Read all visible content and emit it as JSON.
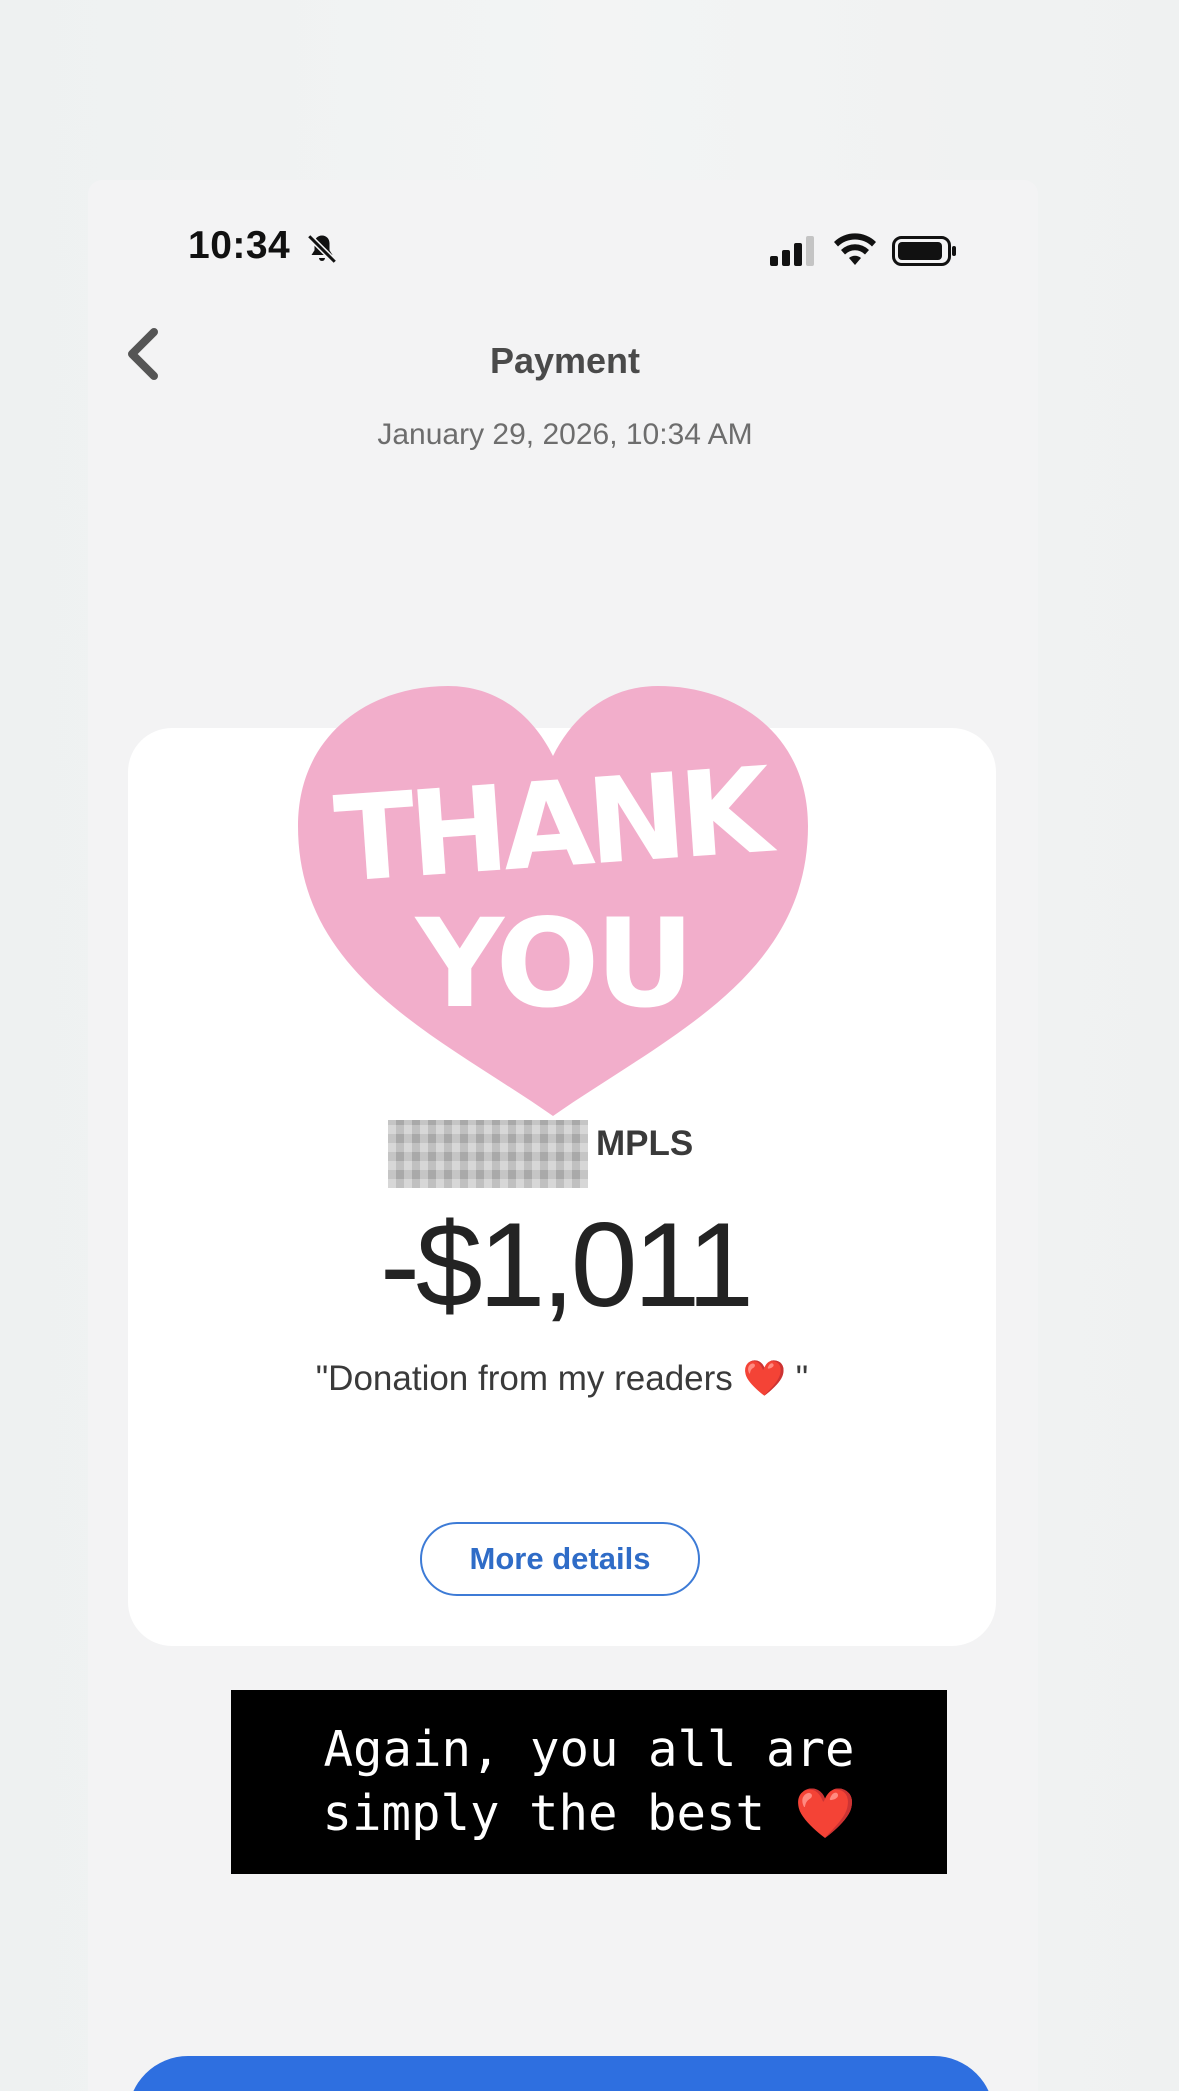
{
  "status_bar": {
    "time": "10:34"
  },
  "header": {
    "title": "Payment",
    "date": "January 29, 2026, 10:34 AM"
  },
  "card": {
    "sticker_text": "THANK YOU",
    "recipient_suffix": "MPLS",
    "amount": "-$1,011",
    "note": "\"Donation from my readers ❤️ \"",
    "more_details_label": "More details"
  },
  "caption": {
    "line1": "Again, you all are",
    "line2": "simply the best ❤️"
  },
  "colors": {
    "accent_blue": "#2e6fe0",
    "sticker_pink": "#f2aecb"
  }
}
